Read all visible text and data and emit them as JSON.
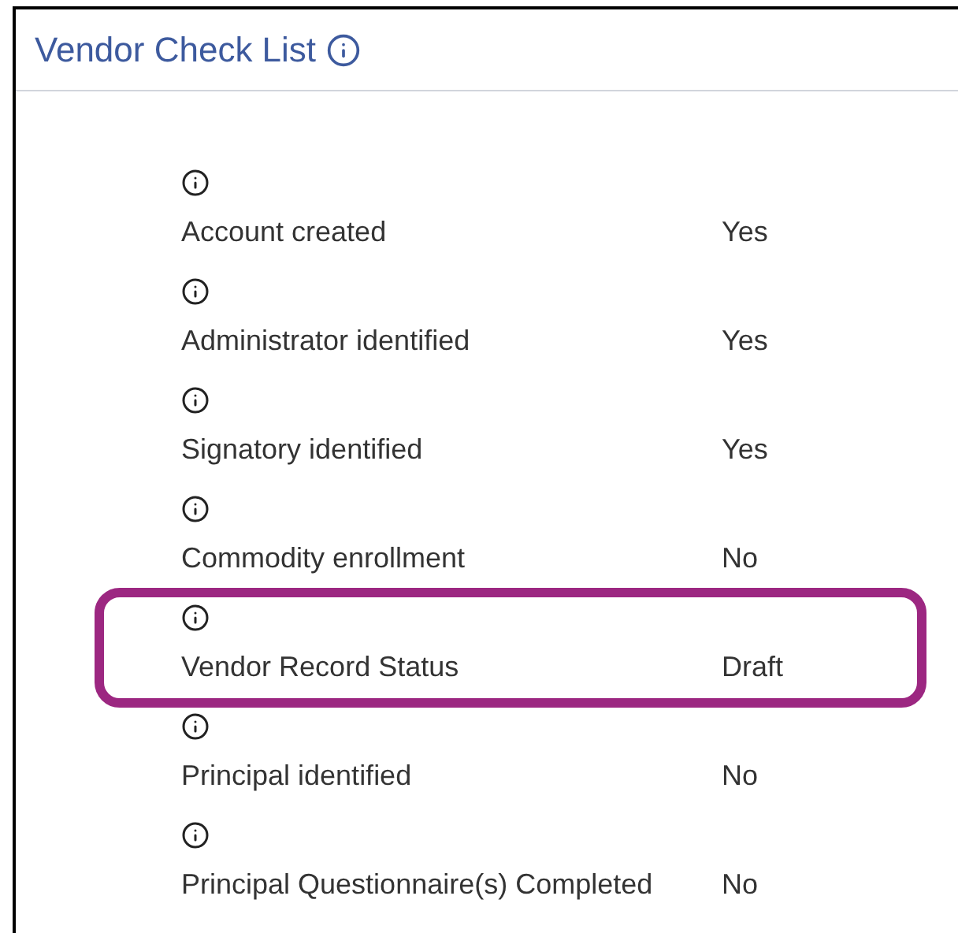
{
  "panel": {
    "title": "Vendor Check List"
  },
  "items": [
    {
      "label": "Account created",
      "value": "Yes",
      "highlighted": false
    },
    {
      "label": "Administrator identified",
      "value": "Yes",
      "highlighted": false
    },
    {
      "label": "Signatory identified",
      "value": "Yes",
      "highlighted": false
    },
    {
      "label": "Commodity enrollment",
      "value": "No",
      "highlighted": false
    },
    {
      "label": "Vendor Record Status",
      "value": "Draft",
      "highlighted": true
    },
    {
      "label": "Principal identified",
      "value": "No",
      "highlighted": false
    },
    {
      "label": "Principal Questionnaire(s) Completed",
      "value": "No",
      "highlighted": false
    }
  ]
}
